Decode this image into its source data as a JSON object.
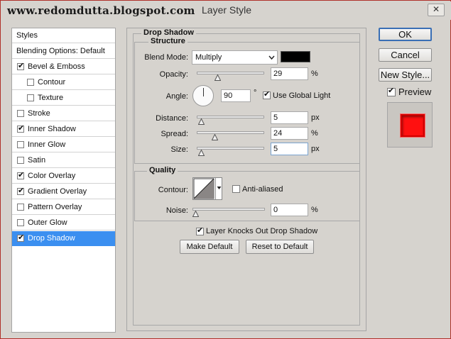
{
  "window": {
    "watermark": "www.redomdutta.blogspot.com",
    "title": "Layer Style",
    "close_glyph": "✕"
  },
  "styles_list": {
    "items": [
      {
        "label": "Styles",
        "checkbox": false,
        "checked": false,
        "selected": false,
        "indent": false
      },
      {
        "label": "Blending Options: Default",
        "checkbox": false,
        "checked": false,
        "selected": false,
        "indent": false
      },
      {
        "label": "Bevel & Emboss",
        "checkbox": true,
        "checked": true,
        "selected": false,
        "indent": false
      },
      {
        "label": "Contour",
        "checkbox": true,
        "checked": false,
        "selected": false,
        "indent": true
      },
      {
        "label": "Texture",
        "checkbox": true,
        "checked": false,
        "selected": false,
        "indent": true
      },
      {
        "label": "Stroke",
        "checkbox": true,
        "checked": false,
        "selected": false,
        "indent": false
      },
      {
        "label": "Inner Shadow",
        "checkbox": true,
        "checked": true,
        "selected": false,
        "indent": false
      },
      {
        "label": "Inner Glow",
        "checkbox": true,
        "checked": false,
        "selected": false,
        "indent": false
      },
      {
        "label": "Satin",
        "checkbox": true,
        "checked": false,
        "selected": false,
        "indent": false
      },
      {
        "label": "Color Overlay",
        "checkbox": true,
        "checked": true,
        "selected": false,
        "indent": false
      },
      {
        "label": "Gradient Overlay",
        "checkbox": true,
        "checked": true,
        "selected": false,
        "indent": false
      },
      {
        "label": "Pattern Overlay",
        "checkbox": true,
        "checked": false,
        "selected": false,
        "indent": false
      },
      {
        "label": "Outer Glow",
        "checkbox": true,
        "checked": false,
        "selected": false,
        "indent": false
      },
      {
        "label": "Drop Shadow",
        "checkbox": true,
        "checked": true,
        "selected": true,
        "indent": false
      }
    ]
  },
  "drop_shadow": {
    "title": "Drop Shadow",
    "structure": {
      "title": "Structure",
      "blend_mode_label": "Blend Mode:",
      "blend_mode_value": "Multiply",
      "shadow_color": "#000000",
      "opacity_label": "Opacity:",
      "opacity_value": "29",
      "opacity_unit": "%",
      "opacity_fraction": 0.29,
      "angle_label": "Angle:",
      "angle_value": "90",
      "angle_unit": "°",
      "use_global_light_label": "Use Global Light",
      "use_global_light": true,
      "distance_label": "Distance:",
      "distance_value": "5",
      "distance_unit": "px",
      "distance_fraction": 0.02,
      "spread_label": "Spread:",
      "spread_value": "24",
      "spread_unit": "%",
      "spread_fraction": 0.24,
      "size_label": "Size:",
      "size_value": "5",
      "size_unit": "px",
      "size_fraction": 0.02
    },
    "quality": {
      "title": "Quality",
      "contour_label": "Contour:",
      "anti_aliased_label": "Anti-aliased",
      "anti_aliased": false,
      "noise_label": "Noise:",
      "noise_value": "0",
      "noise_unit": "%",
      "noise_fraction": 0.0
    },
    "layer_knocks_label": "Layer Knocks Out Drop Shadow",
    "layer_knocks": true,
    "make_default_label": "Make Default",
    "reset_default_label": "Reset to Default"
  },
  "right_buttons": {
    "ok_label": "OK",
    "cancel_label": "Cancel",
    "new_style_label": "New Style...",
    "preview_label": "Preview",
    "preview_checked": true
  },
  "colors": {
    "selection": "#3b8ff0",
    "preview_red": "#ff1010"
  }
}
